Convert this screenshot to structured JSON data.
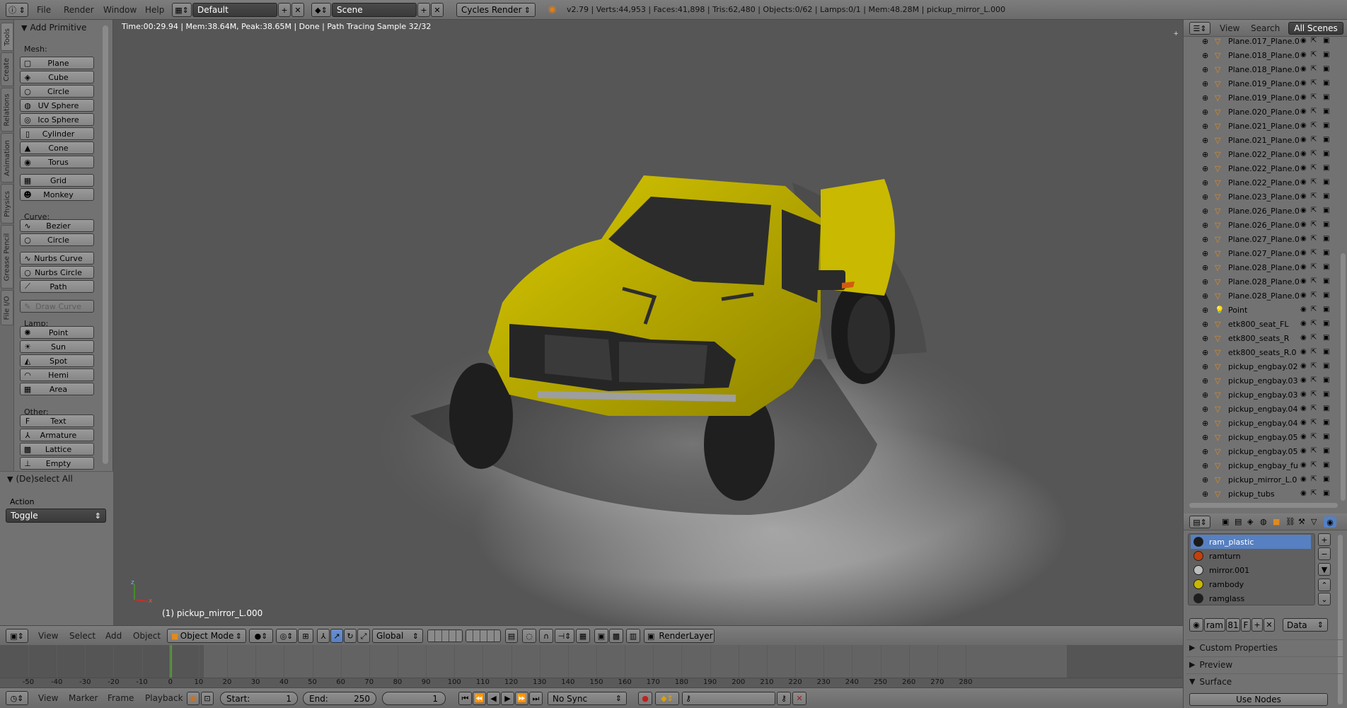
{
  "topbar": {
    "menus": [
      "File",
      "Render",
      "Window",
      "Help"
    ],
    "layout_name": "Default",
    "scene_name": "Scene",
    "engine": "Cycles Render",
    "stats": "v2.79 | Verts:44,953 | Faces:41,898 | Tris:62,480 | Objects:0/62 | Lamps:0/1 | Mem:48.28M | pickup_mirror_L.000"
  },
  "left_tabs": [
    "Tools",
    "Create",
    "Relations",
    "Animation",
    "Physics",
    "Grease Pencil",
    "File I/O"
  ],
  "toolshelf": {
    "section_title": "Add Primitive",
    "mesh_label": "Mesh:",
    "mesh": [
      {
        "label": "Plane",
        "icon": "plane-icon",
        "glyph": "▢"
      },
      {
        "label": "Cube",
        "icon": "cube-icon",
        "glyph": "◈"
      },
      {
        "label": "Circle",
        "icon": "circle-icon",
        "glyph": "○"
      },
      {
        "label": "UV Sphere",
        "icon": "uv-sphere-icon",
        "glyph": "◍"
      },
      {
        "label": "Ico Sphere",
        "icon": "ico-sphere-icon",
        "glyph": "◎"
      },
      {
        "label": "Cylinder",
        "icon": "cylinder-icon",
        "glyph": "▯"
      },
      {
        "label": "Cone",
        "icon": "cone-icon",
        "glyph": "▲"
      },
      {
        "label": "Torus",
        "icon": "torus-icon",
        "glyph": "◉"
      }
    ],
    "mesh2": [
      {
        "label": "Grid",
        "icon": "grid-icon",
        "glyph": "▦"
      },
      {
        "label": "Monkey",
        "icon": "monkey-icon",
        "glyph": "☻"
      }
    ],
    "curve_label": "Curve:",
    "curve": [
      {
        "label": "Bezier",
        "icon": "bezier-icon",
        "glyph": "∿"
      },
      {
        "label": "Circle",
        "icon": "curve-circle-icon",
        "glyph": "○"
      }
    ],
    "curve2": [
      {
        "label": "Nurbs Curve",
        "icon": "nurbs-curve-icon",
        "glyph": "∿"
      },
      {
        "label": "Nurbs Circle",
        "icon": "nurbs-circle-icon",
        "glyph": "○"
      },
      {
        "label": "Path",
        "icon": "path-icon",
        "glyph": "⟋"
      }
    ],
    "draw_curve": "Draw Curve",
    "lamp_label": "Lamp:",
    "lamp": [
      {
        "label": "Point",
        "icon": "point-lamp-icon",
        "glyph": "✺"
      },
      {
        "label": "Sun",
        "icon": "sun-lamp-icon",
        "glyph": "☀"
      },
      {
        "label": "Spot",
        "icon": "spot-lamp-icon",
        "glyph": "◭"
      },
      {
        "label": "Hemi",
        "icon": "hemi-lamp-icon",
        "glyph": "◠"
      },
      {
        "label": "Area",
        "icon": "area-lamp-icon",
        "glyph": "▦"
      }
    ],
    "other_label": "Other:",
    "other": [
      {
        "label": "Text",
        "icon": "text-icon",
        "glyph": "F"
      },
      {
        "label": "Armature",
        "icon": "armature-icon",
        "glyph": "⅄"
      },
      {
        "label": "Lattice",
        "icon": "lattice-icon",
        "glyph": "▩"
      },
      {
        "label": "Empty",
        "icon": "empty-icon",
        "glyph": "⊥"
      }
    ],
    "operator_title": "(De)select All",
    "action_label": "Action",
    "action_value": "Toggle"
  },
  "viewport": {
    "render_info": "Time:00:29.94 | Mem:38.64M, Peak:38.65M | Done | Path Tracing Sample 32/32",
    "active_object": "(1) pickup_mirror_L.000"
  },
  "view_header": {
    "menus": [
      "View",
      "Select",
      "Add",
      "Object"
    ],
    "mode": "Object Mode",
    "orientation": "Global",
    "render_layer": "RenderLayer"
  },
  "timeline": {
    "ticks": [
      -50,
      -40,
      -30,
      -20,
      -10,
      0,
      10,
      20,
      30,
      40,
      50,
      60,
      70,
      80,
      90,
      100,
      110,
      120,
      130,
      140,
      150,
      160,
      170,
      180,
      190,
      200,
      210,
      220,
      230,
      240,
      250,
      260,
      270,
      280
    ],
    "current_frame_value": 0,
    "menus": [
      "View",
      "Marker",
      "Frame",
      "Playback"
    ],
    "start_label": "Start:",
    "start_value": "1",
    "end_label": "End:",
    "end_value": "250",
    "current_frame": "1",
    "sync": "No Sync"
  },
  "outliner": {
    "tabs": [
      "View",
      "Search",
      "All Scenes"
    ],
    "rows": [
      {
        "name": "Plane.017_Plane.0",
        "icon": "mesh-icon"
      },
      {
        "name": "Plane.018_Plane.0",
        "icon": "mesh-icon"
      },
      {
        "name": "Plane.018_Plane.0",
        "icon": "mesh-icon"
      },
      {
        "name": "Plane.019_Plane.0",
        "icon": "mesh-icon"
      },
      {
        "name": "Plane.019_Plane.0",
        "icon": "mesh-icon"
      },
      {
        "name": "Plane.020_Plane.0",
        "icon": "mesh-icon"
      },
      {
        "name": "Plane.021_Plane.0",
        "icon": "mesh-icon"
      },
      {
        "name": "Plane.021_Plane.0",
        "icon": "mesh-icon"
      },
      {
        "name": "Plane.022_Plane.0",
        "icon": "mesh-icon"
      },
      {
        "name": "Plane.022_Plane.0",
        "icon": "mesh-icon"
      },
      {
        "name": "Plane.022_Plane.0",
        "icon": "mesh-icon"
      },
      {
        "name": "Plane.023_Plane.0",
        "icon": "mesh-icon"
      },
      {
        "name": "Plane.026_Plane.0",
        "icon": "mesh-icon"
      },
      {
        "name": "Plane.026_Plane.0",
        "icon": "mesh-icon"
      },
      {
        "name": "Plane.027_Plane.0",
        "icon": "mesh-icon"
      },
      {
        "name": "Plane.027_Plane.0",
        "icon": "mesh-icon"
      },
      {
        "name": "Plane.028_Plane.0",
        "icon": "mesh-icon"
      },
      {
        "name": "Plane.028_Plane.0",
        "icon": "mesh-icon"
      },
      {
        "name": "Plane.028_Plane.0",
        "icon": "mesh-icon"
      },
      {
        "name": "Point",
        "icon": "lamp-icon"
      },
      {
        "name": "etk800_seat_FL",
        "icon": "mesh-icon"
      },
      {
        "name": "etk800_seats_R",
        "icon": "mesh-icon"
      },
      {
        "name": "etk800_seats_R.0",
        "icon": "mesh-icon"
      },
      {
        "name": "pickup_engbay.02",
        "icon": "mesh-icon"
      },
      {
        "name": "pickup_engbay.03",
        "icon": "mesh-icon"
      },
      {
        "name": "pickup_engbay.03",
        "icon": "mesh-icon"
      },
      {
        "name": "pickup_engbay.04",
        "icon": "mesh-icon"
      },
      {
        "name": "pickup_engbay.04",
        "icon": "mesh-icon"
      },
      {
        "name": "pickup_engbay.05",
        "icon": "mesh-icon"
      },
      {
        "name": "pickup_engbay.05",
        "icon": "mesh-icon"
      },
      {
        "name": "pickup_engbay_ful",
        "icon": "mesh-icon"
      },
      {
        "name": "pickup_mirror_L.0",
        "icon": "mesh-icon"
      },
      {
        "name": "pickup_tubs",
        "icon": "mesh-icon"
      }
    ]
  },
  "properties": {
    "materials": [
      {
        "name": "ram_plastic",
        "color": "#1b1b1b",
        "selected": true
      },
      {
        "name": "ramturn",
        "color": "#c2400c",
        "selected": false
      },
      {
        "name": "mirror.001",
        "color": "#bdbdbd",
        "selected": false
      },
      {
        "name": "rambody",
        "color": "#c9b800",
        "selected": false
      },
      {
        "name": "ramglass",
        "color": "#1e1e1e",
        "selected": false
      }
    ],
    "material_field": "ram",
    "user_count": "81",
    "fake_user": "F",
    "link": "Data",
    "panels": [
      "Custom Properties",
      "Preview",
      "Surface"
    ],
    "use_nodes": "Use Nodes"
  },
  "colors": {
    "selection": "#5680c2",
    "body_yellow": "#d4c400"
  }
}
